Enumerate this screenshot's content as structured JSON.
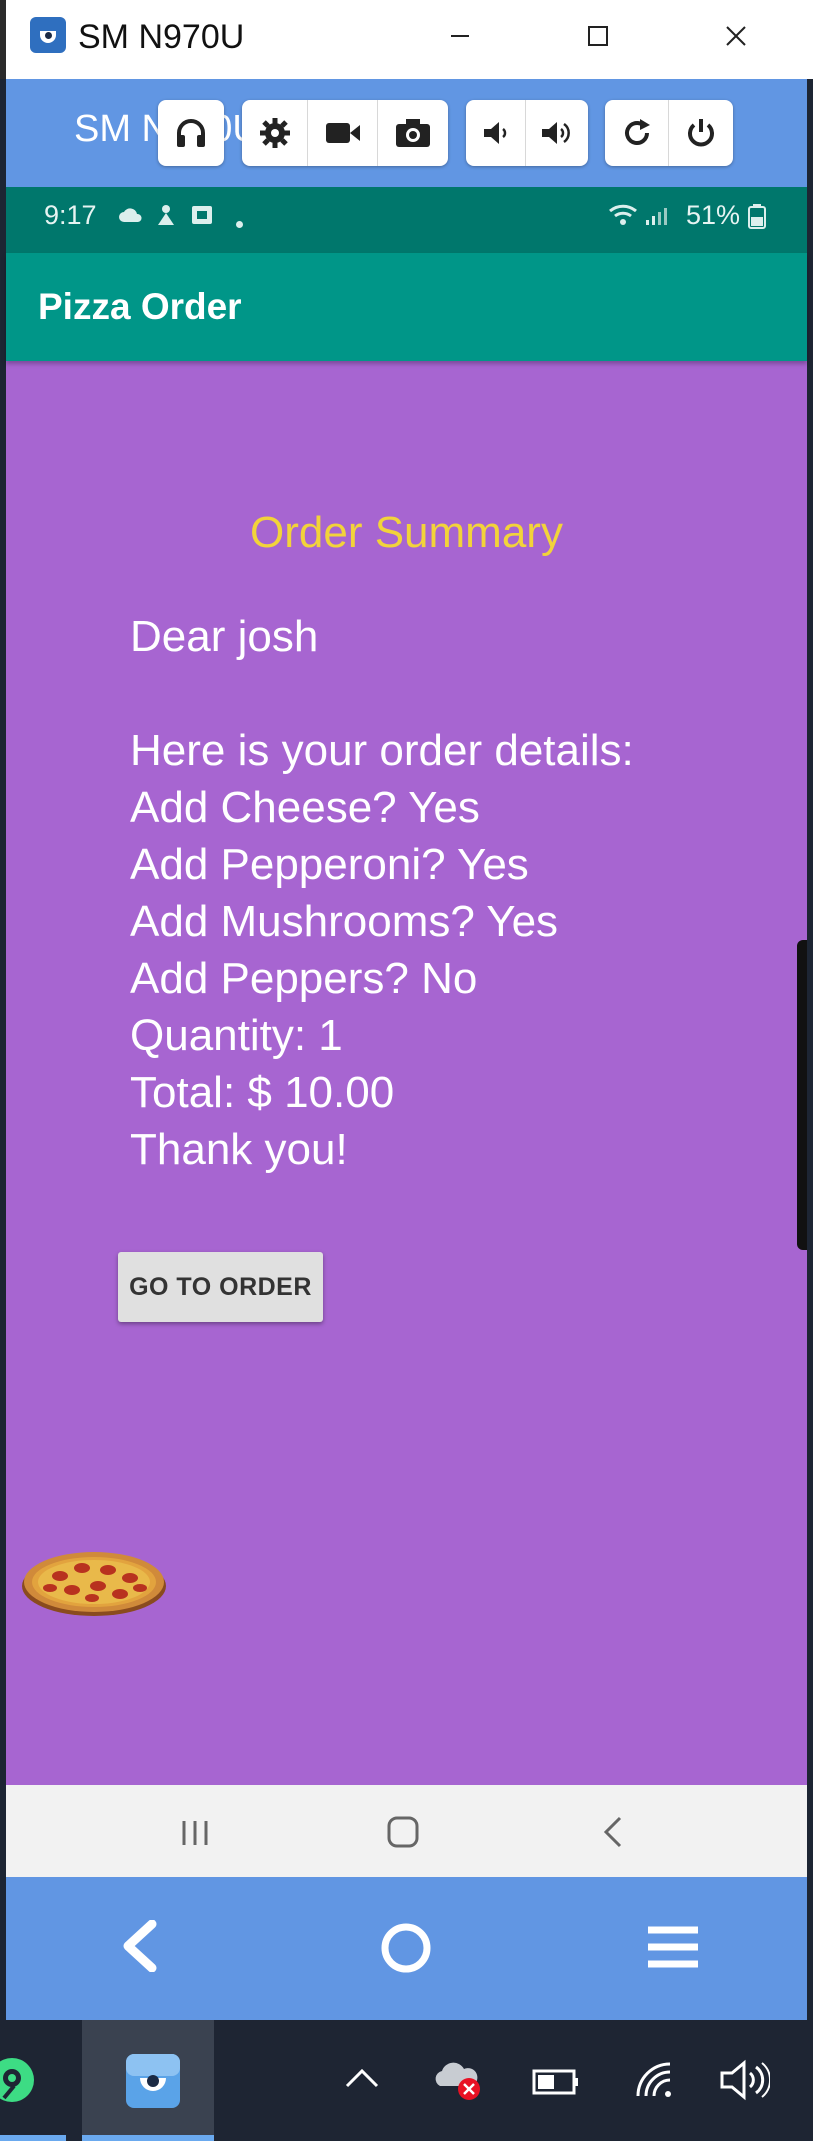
{
  "window": {
    "title": "SM N970U",
    "minimize_icon": "minimize-icon",
    "maximize_icon": "maximize-icon",
    "close_icon": "close-icon"
  },
  "scrcpy_toolbar": {
    "device_label": "SM N970U",
    "buttons": [
      "headphones-icon",
      "settings-icon",
      "video-camera-icon",
      "camera-icon",
      "volume-down-icon",
      "volume-up-icon",
      "rotate-icon",
      "power-icon"
    ],
    "accent_color": "#6196e3"
  },
  "status_bar": {
    "time": "9:17",
    "battery": "51%",
    "color": "#00776c"
  },
  "app_bar": {
    "title": "Pizza Order",
    "color": "#009688"
  },
  "summary": {
    "heading": "Order Summary",
    "heading_color": "#f2d33a",
    "background_color": "#a765d1",
    "lines": [
      "Dear josh",
      "",
      "Here is your order details:",
      "Add Cheese? Yes",
      "Add Pepperoni? Yes",
      "Add Mushrooms? Yes",
      "Add Peppers? No",
      "Quantity: 1",
      "Total: $ 10.00",
      "Thank you!"
    ],
    "button_label": "GO TO ORDER"
  },
  "android_nav": {
    "buttons": [
      "recent-apps-icon",
      "home-icon",
      "back-icon"
    ]
  },
  "scrcpy_nav": {
    "buttons": [
      "back-arrow-icon",
      "home-circle-icon",
      "menu-icon"
    ]
  },
  "taskbar": {
    "items": [
      "android-studio-icon",
      "scrcpy-icon"
    ],
    "tray": [
      "chevron-up-icon",
      "onedrive-error-icon",
      "battery-icon",
      "wifi-icon",
      "volume-icon"
    ]
  }
}
